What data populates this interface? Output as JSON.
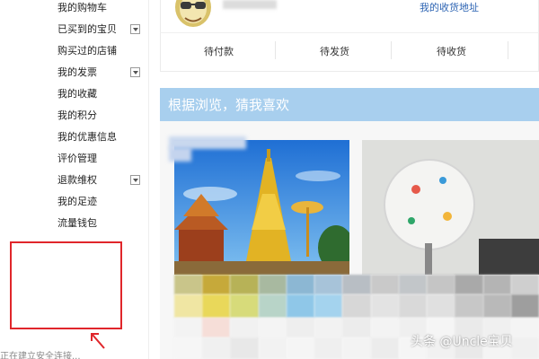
{
  "sidebar": {
    "items": [
      {
        "label": "我的购物车",
        "has_toggle": false
      },
      {
        "label": "已买到的宝贝",
        "has_toggle": true
      },
      {
        "label": "购买过的店铺",
        "has_toggle": false
      },
      {
        "label": "我的发票",
        "has_toggle": true
      },
      {
        "label": "我的收藏",
        "has_toggle": false
      },
      {
        "label": "我的积分",
        "has_toggle": false
      },
      {
        "label": "我的优惠信息",
        "has_toggle": false
      },
      {
        "label": "评价管理",
        "has_toggle": false
      },
      {
        "label": "退款维权",
        "has_toggle": true
      },
      {
        "label": "我的足迹",
        "has_toggle": false
      },
      {
        "label": "流量钱包",
        "has_toggle": false
      }
    ],
    "status_text": "正在建立安全连接..."
  },
  "header": {
    "address_link": "我的收货地址"
  },
  "order_tabs": [
    {
      "label": "待付款"
    },
    {
      "label": "待发货"
    },
    {
      "label": "待收货"
    }
  ],
  "recommend": {
    "title": "根据浏览，猜我喜欢"
  },
  "watermark": "头条 @Uncle宝贝",
  "colors": {
    "highlight_box": "#e0262b",
    "banner": "#a8cfee",
    "link": "#2d64b3"
  }
}
